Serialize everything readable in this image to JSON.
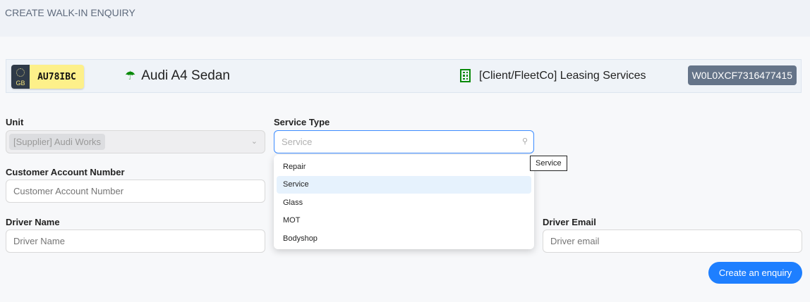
{
  "page": {
    "title": "CREATE WALK-IN ENQUIRY"
  },
  "vehicle": {
    "country": "GB",
    "registration": "AU78IBC",
    "model": "Audi A4 Sedan",
    "client": "[Client/FleetCo] Leasing Services",
    "vin": "W0L0XCF7316477415"
  },
  "form": {
    "unit": {
      "label": "Unit",
      "value": "[Supplier] Audi Works"
    },
    "service_type": {
      "label": "Service Type",
      "placeholder": "Service",
      "options": [
        "Repair",
        "Service",
        "Glass",
        "MOT",
        "Bodyshop"
      ],
      "highlighted": "Service",
      "tooltip": "Service"
    },
    "customer_account": {
      "label": "Customer Account Number",
      "placeholder": "Customer Account Number"
    },
    "driver_name": {
      "label": "Driver Name",
      "placeholder": "Driver Name"
    },
    "driver_email": {
      "label": "Driver Email",
      "placeholder": "Driver email"
    },
    "submit_label": "Create an enquiry"
  }
}
